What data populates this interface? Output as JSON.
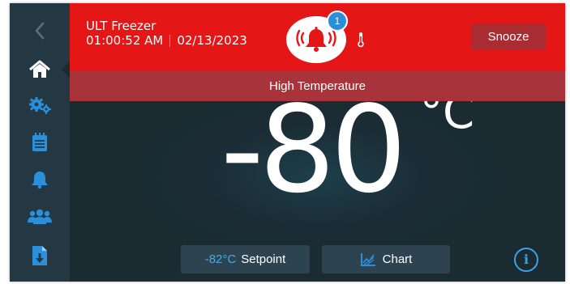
{
  "header": {
    "device_name": "ULT Freezer",
    "time": "01:00:52 AM",
    "date": "02/13/2023",
    "alarm_count": "1",
    "snooze_label": "Snooze",
    "alarm_message": "High Temperature"
  },
  "display": {
    "temperature": "-80",
    "unit": "°C"
  },
  "footer": {
    "setpoint_value": "-82°C",
    "setpoint_label": "Setpoint",
    "chart_label": "Chart",
    "info_label": "i"
  },
  "sidebar": {
    "items": [
      {
        "icon": "back-chevron-icon",
        "active": false
      },
      {
        "icon": "home-icon",
        "active": true
      },
      {
        "icon": "settings-gears-icon",
        "active": false
      },
      {
        "icon": "notepad-icon",
        "active": false
      },
      {
        "icon": "bell-icon",
        "active": false
      },
      {
        "icon": "users-icon",
        "active": false
      },
      {
        "icon": "export-file-icon",
        "active": false
      }
    ]
  },
  "colors": {
    "alarm_red": "#e41616",
    "banner_red": "#a9333b",
    "sidebar_bg": "#233843",
    "main_bg": "#1a2b32",
    "accent_blue": "#3ea1e6"
  }
}
